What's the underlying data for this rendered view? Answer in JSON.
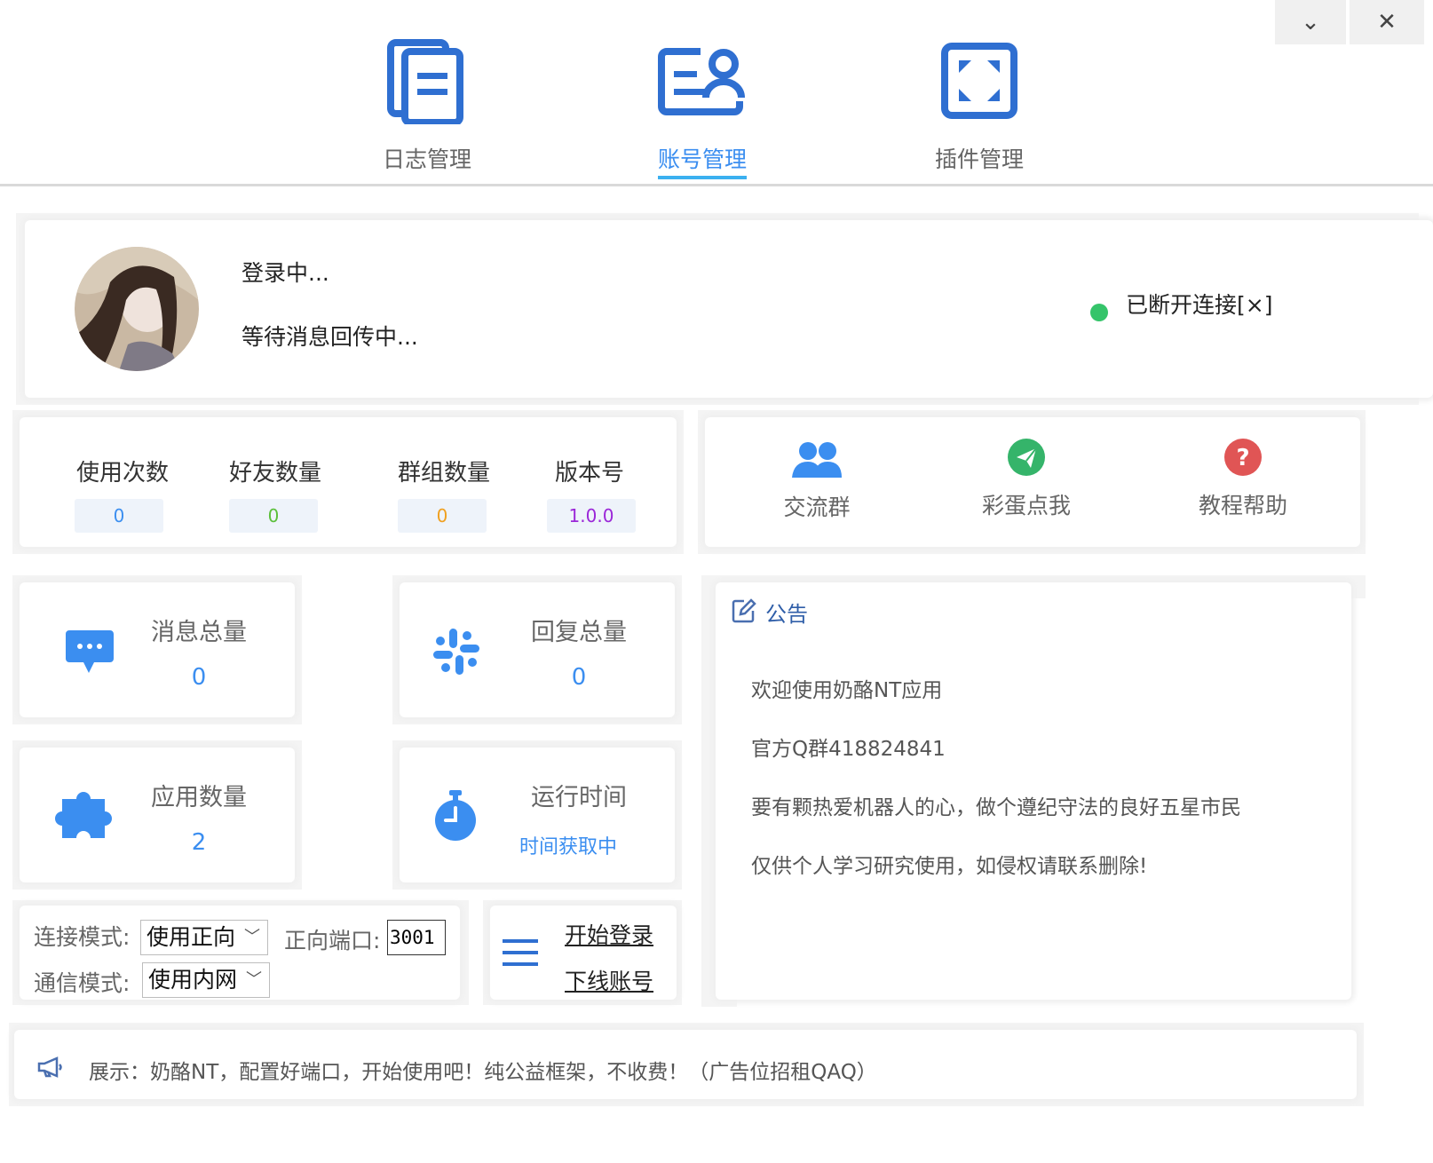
{
  "window": {
    "minimize_glyph": "⌄",
    "close_glyph": "✕"
  },
  "nav": [
    {
      "label": "日志管理",
      "icon": "log-document-icon",
      "active": false
    },
    {
      "label": "账号管理",
      "icon": "account-card-icon",
      "active": true
    },
    {
      "label": "插件管理",
      "icon": "plugin-frame-icon",
      "active": false
    }
  ],
  "profile": {
    "status_line1": "登录中...",
    "status_line2": "等待消息回传中...",
    "connection_text": "已断开连接[×]",
    "connection_color": "#35c46a"
  },
  "stats": [
    {
      "title": "使用次数",
      "value": "0",
      "color": "#3b8ef0"
    },
    {
      "title": "好友数量",
      "value": "0",
      "color": "#5bbf3a"
    },
    {
      "title": "群组数量",
      "value": "0",
      "color": "#f0a020"
    },
    {
      "title": "版本号",
      "value": "1.0.0",
      "color": "#9b27d8"
    }
  ],
  "quick_links": [
    {
      "label": "交流群",
      "icon": "users-icon",
      "color": "#3b8ef0"
    },
    {
      "label": "彩蛋点我",
      "icon": "paper-plane-icon",
      "color": "#35b46a"
    },
    {
      "label": "教程帮助",
      "icon": "question-icon",
      "color": "#e05555"
    }
  ],
  "metrics": [
    {
      "title": "消息总量",
      "value": "0",
      "icon": "chat-bubble-icon"
    },
    {
      "title": "回复总量",
      "value": "0",
      "icon": "slack-icon"
    },
    {
      "title": "应用数量",
      "value": "2",
      "icon": "puzzle-icon"
    },
    {
      "title": "运行时间",
      "value": "时间获取中",
      "icon": "stopwatch-icon"
    }
  ],
  "settings": {
    "connect_mode_label": "连接模式:",
    "connect_mode_value": "使用正向",
    "port_label": "正向端口:",
    "port_value": "3001",
    "comm_mode_label": "通信模式:",
    "comm_mode_value": "使用内网"
  },
  "actions": {
    "start_login": "开始登录",
    "logout": "下线账号"
  },
  "notice": {
    "title": "公告",
    "lines": [
      "欢迎使用奶酪NT应用",
      "官方Q群418824841",
      "要有颗热爱机器人的心，做个遵纪守法的良好五星市民",
      "仅供个人学习研究使用，如侵权请联系删除!"
    ]
  },
  "banner": {
    "text": "展示：奶酪NT，配置好端口，开始使用吧！纯公益框架，不收费！（广告位招租QAQ）"
  },
  "colors": {
    "accent": "#3b8ef0",
    "icon_blue": "#2f6fd1"
  }
}
